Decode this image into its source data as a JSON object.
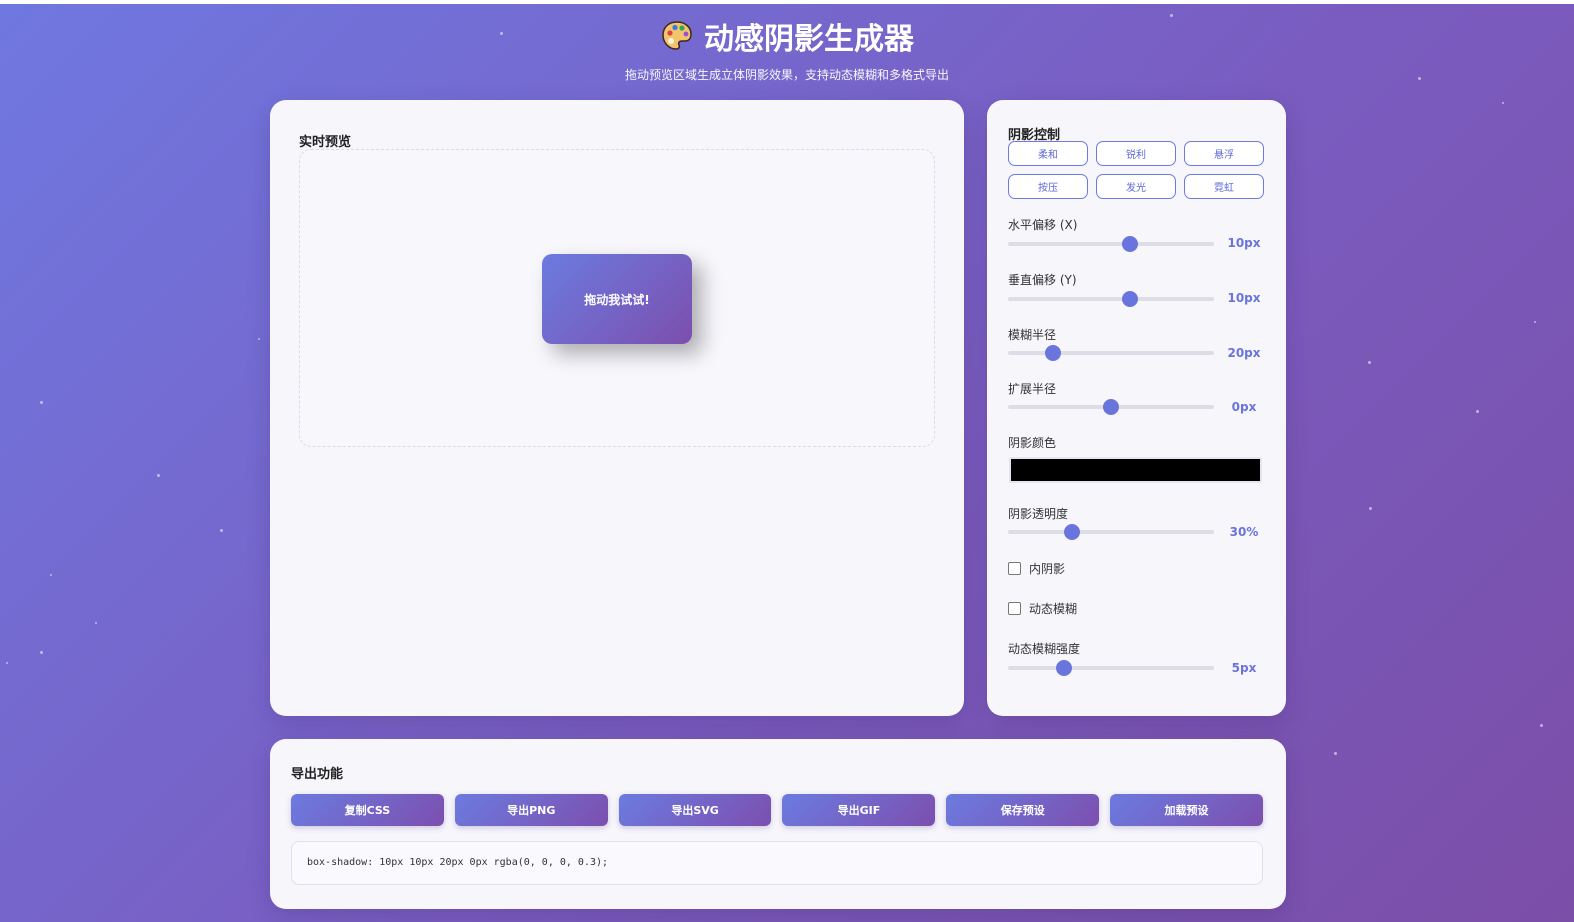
{
  "header": {
    "title": "动感阴影生成器",
    "subtitle": "拖动预览区域生成立体阴影效果，支持动态模糊和多格式导出",
    "icon": "palette-icon"
  },
  "preview": {
    "title": "实时预览",
    "box_label": "拖动我试试!"
  },
  "controls": {
    "title": "阴影控制",
    "presets": [
      "柔和",
      "锐利",
      "悬浮",
      "按压",
      "发光",
      "霓虹"
    ],
    "x_offset": {
      "label": "水平偏移 (X)",
      "value": "10px",
      "fraction": 0.59
    },
    "y_offset": {
      "label": "垂直偏移 (Y)",
      "value": "10px",
      "fraction": 0.59
    },
    "blur": {
      "label": "模糊半径",
      "value": "20px",
      "fraction": 0.22
    },
    "spread": {
      "label": "扩展半径",
      "value": "0px",
      "fraction": 0.5
    },
    "color": {
      "label": "阴影颜色",
      "value": "#000000"
    },
    "opacity": {
      "label": "阴影透明度",
      "value": "30%",
      "fraction": 0.31
    },
    "inset": {
      "label": "内阴影",
      "checked": false
    },
    "motion_blur": {
      "label": "动态模糊",
      "checked": false
    },
    "motion_strength": {
      "label": "动态模糊强度",
      "value": "5px",
      "fraction": 0.27
    }
  },
  "export": {
    "title": "导出功能",
    "buttons": [
      "复制CSS",
      "导出PNG",
      "导出SVG",
      "导出GIF",
      "保存预设",
      "加载预设"
    ],
    "code": "box-shadow: 10px 10px 20px 0px rgba(0, 0, 0, 0.3);"
  },
  "colors": {
    "accent": "#6a74dd",
    "gradient_start": "#6c7be0",
    "gradient_end": "#7c4fae"
  }
}
